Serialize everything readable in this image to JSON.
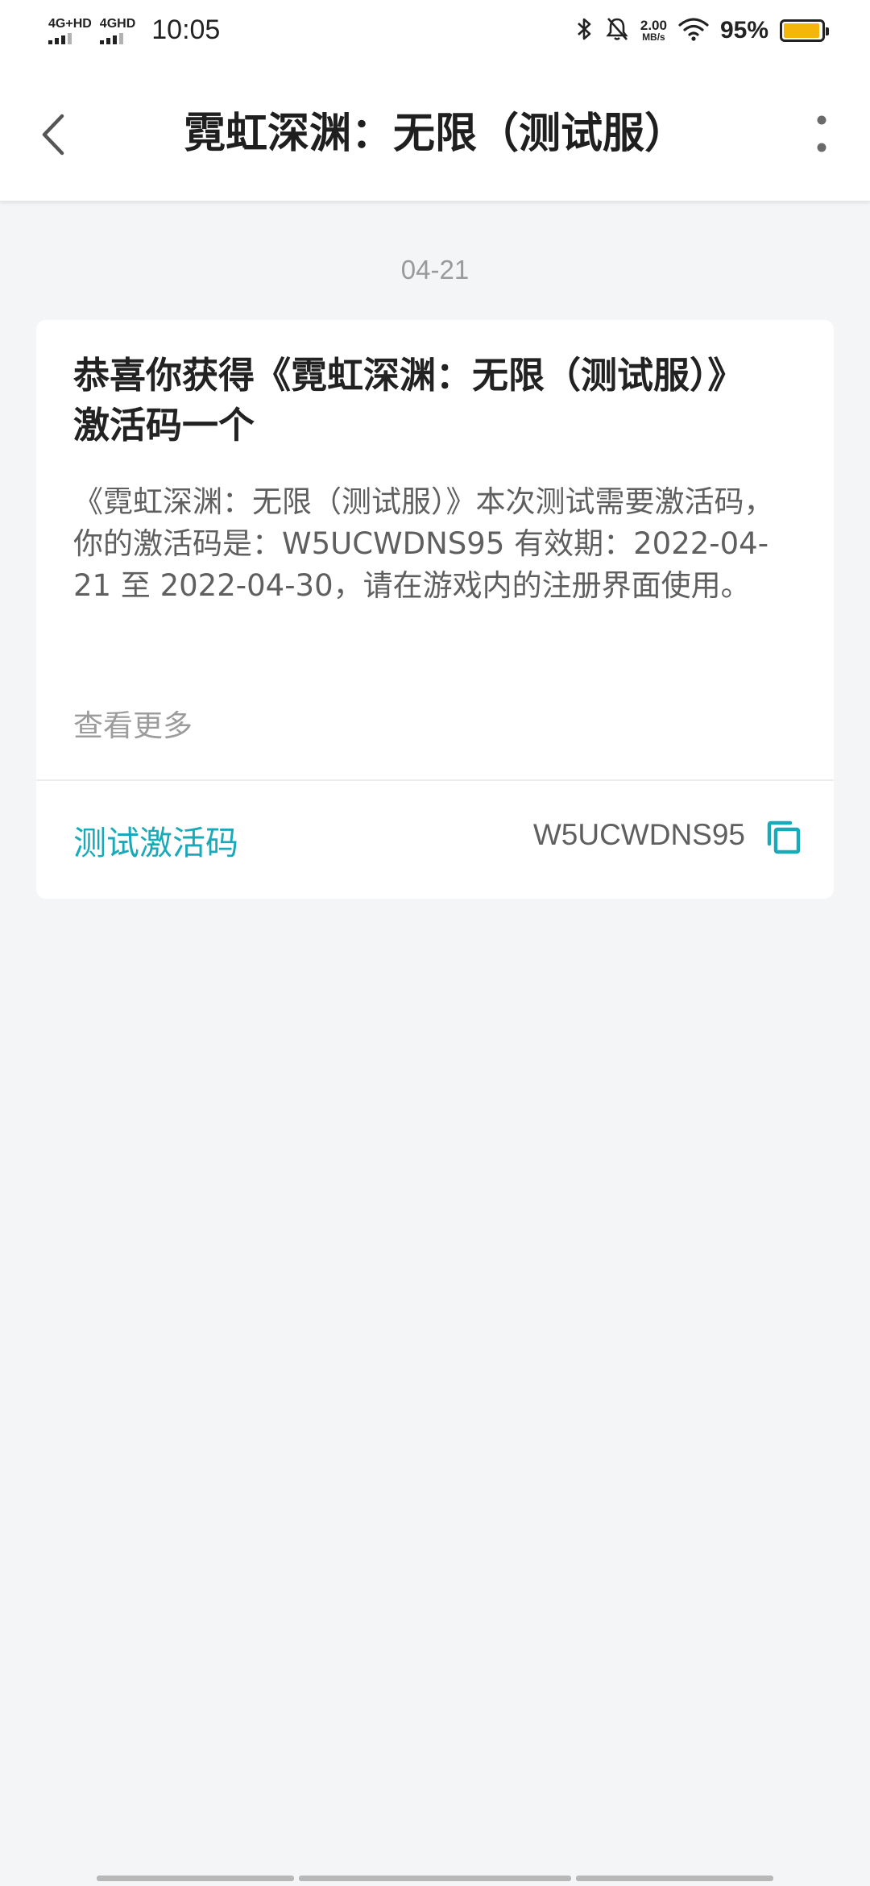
{
  "status_bar": {
    "signal1": "4G+HD",
    "signal2": "4GHD",
    "time": "10:05",
    "net_speed_value": "2.00",
    "net_speed_unit": "MB/s",
    "battery_percent": "95%",
    "battery_level": 0.95,
    "battery_color": "#f5b50b",
    "icons": [
      "bluetooth-icon",
      "mute-icon",
      "wifi-icon",
      "battery-icon"
    ]
  },
  "header": {
    "title": "霓虹深渊：无限（测试服）",
    "back_icon": "chevron-left-icon",
    "more_icon": "more-vertical-icon"
  },
  "message": {
    "date": "04-21",
    "title": "恭喜你获得《霓虹深渊：无限（测试服）》激活码一个",
    "body": "《霓虹深渊：无限（测试服）》本次测试需要激活码，你的激活码是：W5UCWDNS95 有效期：2022-04-21 至 2022-04-30，请在游戏内的注册界面使用。",
    "see_more": "查看更多",
    "code_label": "测试激活码",
    "code_value": "W5UCWDNS95",
    "copy_icon": "copy-icon"
  },
  "colors": {
    "accent": "#1aa9b8",
    "background": "#f4f5f7",
    "card": "#ffffff"
  }
}
